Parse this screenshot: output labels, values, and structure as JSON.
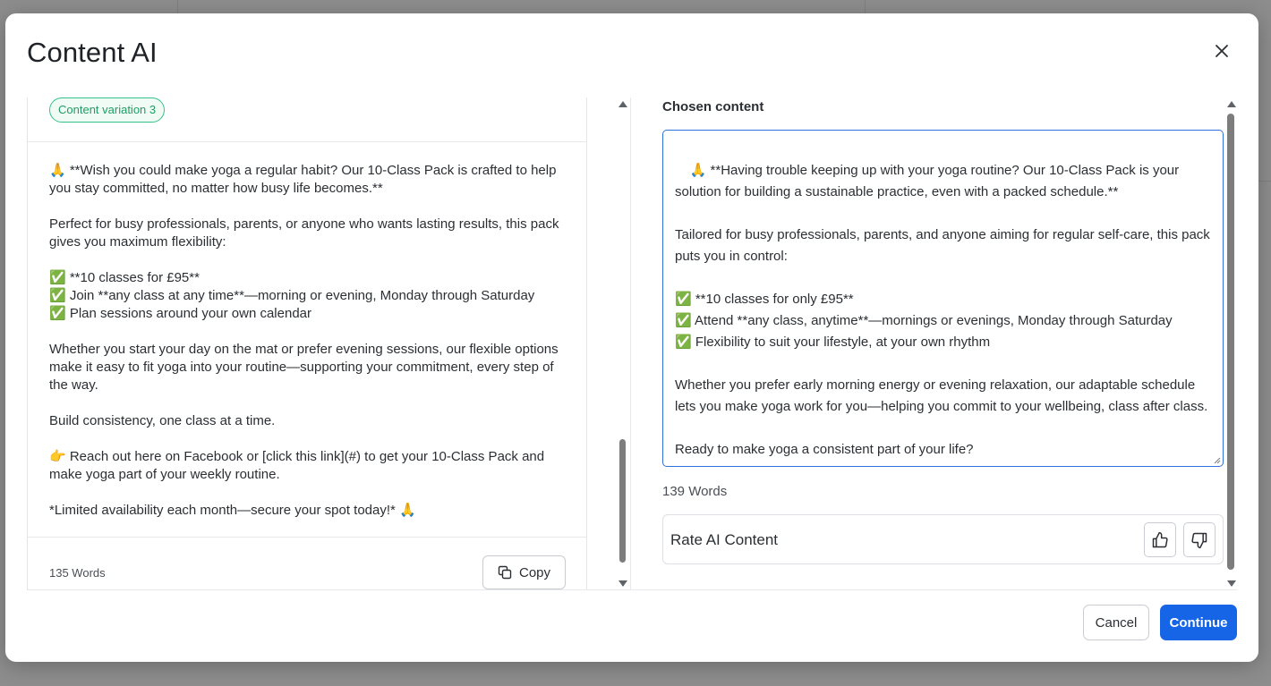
{
  "modal": {
    "title": "Content AI"
  },
  "left_panel": {
    "badge": "Content variation 3",
    "body": "🙏 **Wish you could make yoga a regular habit? Our 10-Class Pack is crafted to help you stay committed, no matter how busy life becomes.**\n\nPerfect for busy professionals, parents, or anyone who wants lasting results, this pack gives you maximum flexibility:\n\n✅ **10 classes for £95**\n✅ Join **any class at any time**—morning or evening, Monday through Saturday\n✅ Plan sessions around your own calendar\n\nWhether you start your day on the mat or prefer evening sessions, our flexible options make it easy to fit yoga into your routine—supporting your commitment, every step of the way.\n\nBuild consistency, one class at a time.\n\n👉 Reach out here on Facebook or [click this link](#) to get your 10-Class Pack and make yoga part of your weekly routine.\n\n*Limited availability each month—secure your spot today!* 🙏",
    "word_count": "135 Words",
    "copy_label": "Copy"
  },
  "right_panel": {
    "label": "Chosen content",
    "content": "🙏 **Having trouble keeping up with your yoga routine? Our 10-Class Pack is your solution for building a sustainable practice, even with a packed schedule.**\n\nTailored for busy professionals, parents, and anyone aiming for regular self-care, this pack puts you in control:\n\n✅ **10 classes for only £95**\n✅ Attend **any class, anytime**—mornings or evenings, Monday through Saturday\n✅ Flexibility to suit your lifestyle, at your own rhythm\n\nWhether you prefer early morning energy or evening relaxation, our adaptable schedule lets you make yoga work for you—helping you commit to your wellbeing, class after class.\n\nReady to make yoga a consistent part of your life?",
    "word_count": "139 Words",
    "rate_label": "Rate AI Content"
  },
  "footer": {
    "cancel_label": "Cancel",
    "continue_label": "Continue"
  },
  "colors": {
    "accent": "#1565e6",
    "badge_green": "#1f9d63",
    "textarea_border": "#2f6fdb"
  },
  "icons": {
    "close": "close-icon",
    "copy": "copy-icon",
    "thumbs_up": "thumbs-up-icon",
    "thumbs_down": "thumbs-down-icon"
  }
}
